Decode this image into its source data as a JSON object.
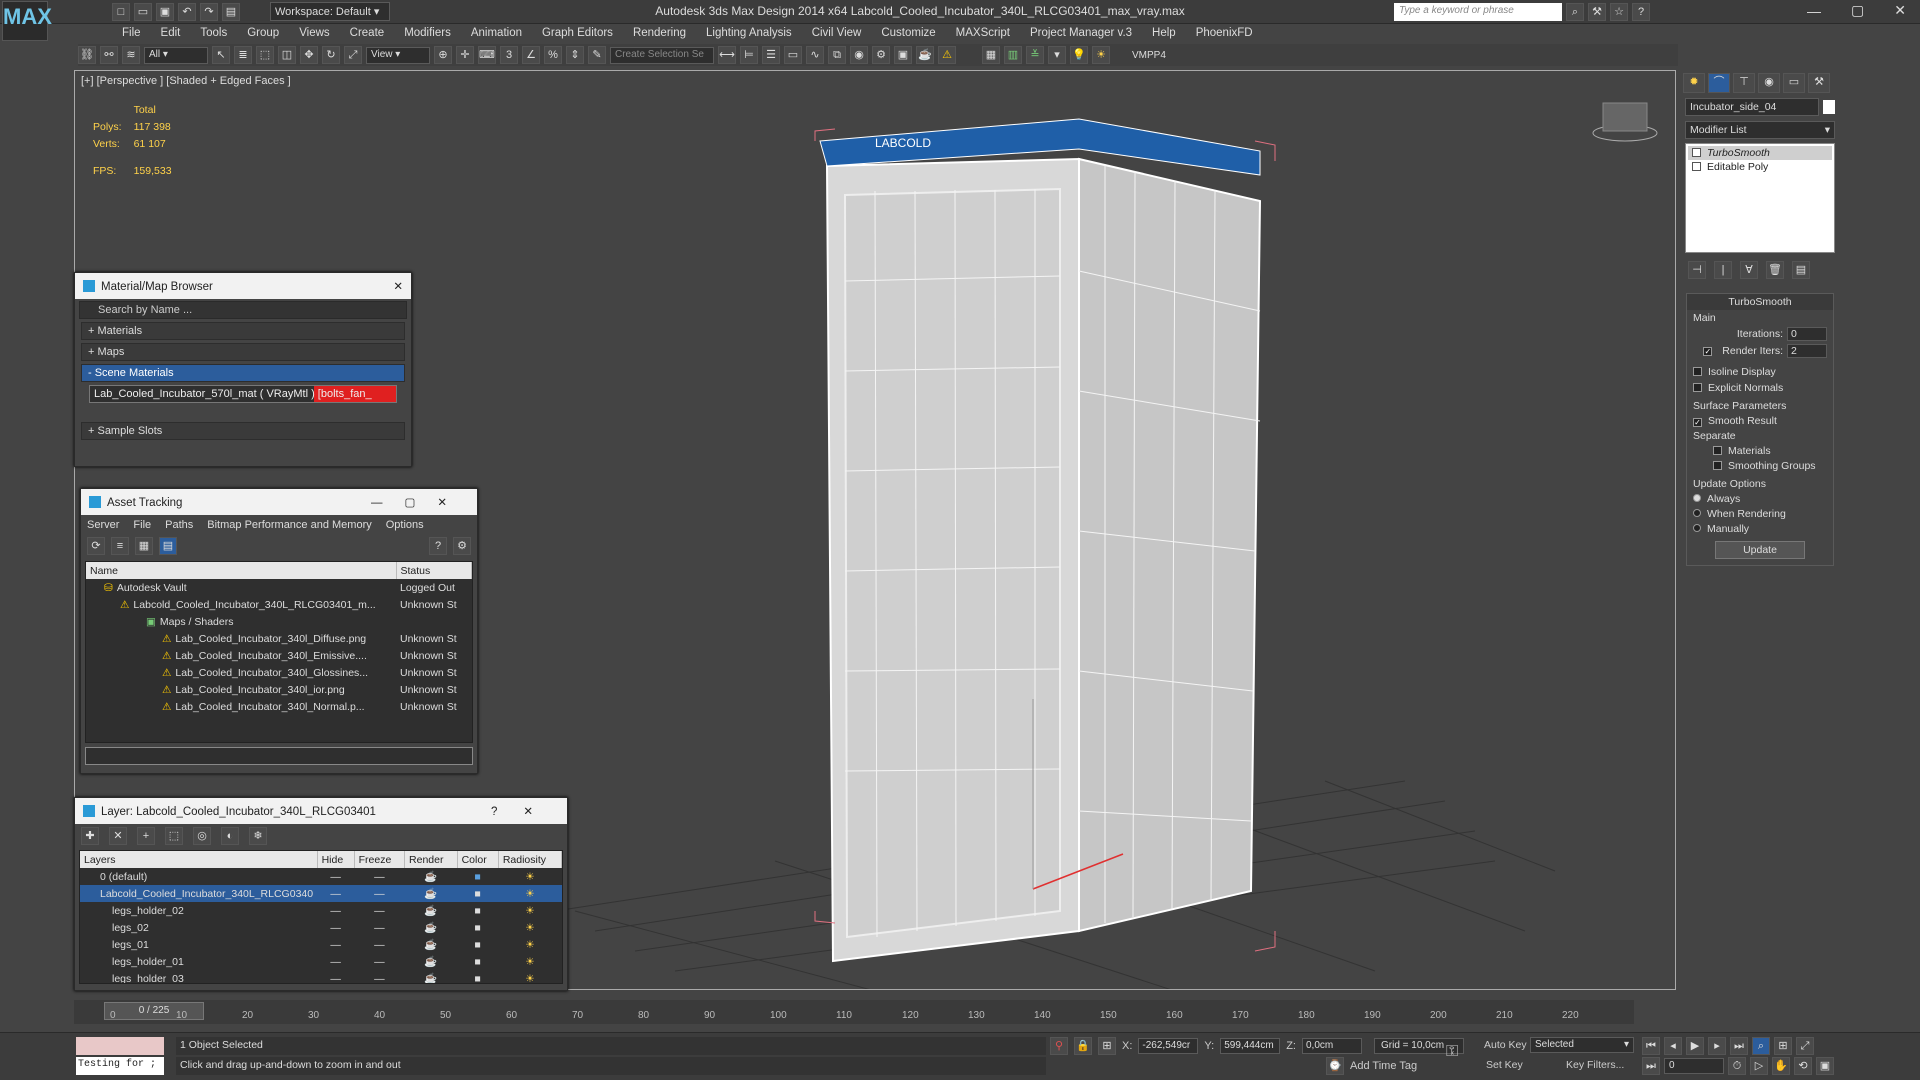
{
  "app": {
    "logo": "MAX",
    "window_title": "Autodesk 3ds Max Design 2014 x64       Labcold_Cooled_Incubator_340L_RLCG03401_max_vray.max",
    "workspace": "Workspace: Default",
    "search_placeholder": "Type a keyword or phrase"
  },
  "menu": [
    "File",
    "Edit",
    "Tools",
    "Group",
    "Views",
    "Create",
    "Modifiers",
    "Animation",
    "Graph Editors",
    "Rendering",
    "Lighting Analysis",
    "Civil View",
    "Customize",
    "MAXScript",
    "Project Manager v.3",
    "Help",
    "PhoenixFD"
  ],
  "toolbar": {
    "selection_filter": "All",
    "ref_coord": "View",
    "named_selection_placeholder": "Create Selection Se",
    "vmpp": "VMPP4"
  },
  "viewport": {
    "label": "[+] [Perspective ] [Shaded + Edged Faces ]",
    "stats": {
      "header": "Total",
      "polys_label": "Polys:",
      "polys": "117 398",
      "verts_label": "Verts:",
      "verts": "61 107",
      "fps_label": "FPS:",
      "fps": "159,533"
    }
  },
  "material_browser": {
    "title": "Material/Map Browser",
    "search_placeholder": "Search by Name ...",
    "sections": [
      "+ Materials",
      "+ Maps",
      "- Scene Materials"
    ],
    "material_item": "Lab_Cooled_Incubator_570l_mat ( VRayMtl ) [bolts_fan_",
    "sample_slots": "+ Sample Slots"
  },
  "asset_tracking": {
    "title": "Asset Tracking",
    "menu": [
      "Server",
      "File",
      "Paths",
      "Bitmap Performance and Memory",
      "Options"
    ],
    "col_name": "Name",
    "col_status": "Status",
    "rows": [
      {
        "name": "Autodesk Vault",
        "status": "Logged Out"
      },
      {
        "name": "Labcold_Cooled_Incubator_340L_RLCG03401_m...",
        "status": "Unknown St"
      },
      {
        "name": "Maps / Shaders",
        "status": ""
      },
      {
        "name": "Lab_Cooled_Incubator_340l_Diffuse.png",
        "status": "Unknown St"
      },
      {
        "name": "Lab_Cooled_Incubator_340l_Emissive....",
        "status": "Unknown St"
      },
      {
        "name": "Lab_Cooled_Incubator_340l_Glossines...",
        "status": "Unknown St"
      },
      {
        "name": "Lab_Cooled_Incubator_340l_ior.png",
        "status": "Unknown St"
      },
      {
        "name": "Lab_Cooled_Incubator_340l_Normal.p...",
        "status": "Unknown St"
      }
    ]
  },
  "layer_manager": {
    "title": "Layer: Labcold_Cooled_Incubator_340L_RLCG03401",
    "help": "?",
    "cols": [
      "Layers",
      "Hide",
      "Freeze",
      "Render",
      "Color",
      "Radiosity"
    ],
    "rows": [
      {
        "name": "0 (default)"
      },
      {
        "name": "Labcold_Cooled_Incubator_340L_RLCG0340"
      },
      {
        "name": "legs_holder_02"
      },
      {
        "name": "legs_02"
      },
      {
        "name": "legs_01"
      },
      {
        "name": "legs_holder_01"
      },
      {
        "name": "legs_holder_03"
      }
    ]
  },
  "command_panel": {
    "object_name": "Incubator_side_04",
    "modifier_list": "Modifier List",
    "stack": [
      "TurboSmooth",
      "Editable Poly"
    ],
    "turbosmooth": {
      "title": "TurboSmooth",
      "main": "Main",
      "iterations_label": "Iterations:",
      "iterations": "0",
      "render_iters_label": "Render Iters:",
      "render_iters": "2",
      "isoline": "Isoline Display",
      "explicit_normals": "Explicit Normals",
      "surface_params": "Surface Parameters",
      "smooth_result": "Smooth Result",
      "separate": "Separate",
      "materials": "Materials",
      "smoothing_groups": "Smoothing Groups",
      "update_options": "Update Options",
      "always": "Always",
      "when_rendering": "When Rendering",
      "manually": "Manually",
      "update_btn": "Update"
    }
  },
  "timeline": {
    "frame": "0 / 225",
    "ticks": [
      "0",
      "10",
      "20",
      "30",
      "40",
      "50",
      "60",
      "70",
      "80",
      "90",
      "100",
      "110",
      "120",
      "130",
      "140",
      "150",
      "160",
      "170",
      "180",
      "190",
      "200",
      "210",
      "220"
    ]
  },
  "status": {
    "script_text": "Testing for ;",
    "selected": "1 Object Selected",
    "prompt": "Click and drag up-and-down to zoom in and out",
    "x_label": "X:",
    "x": "-262,549cr",
    "y_label": "Y:",
    "y": "599,444cm",
    "z_label": "Z:",
    "z": "0,0cm",
    "grid": "Grid = 10,0cm",
    "add_time_tag": "Add Time Tag",
    "auto_key": "Auto Key",
    "set_key": "Set Key",
    "selected_dd": "Selected",
    "key_filters": "Key Filters...",
    "frame_field": "0"
  },
  "colors": {
    "accent": "#2c5d9c",
    "selection_red": "#e02020",
    "stats_yellow": "#ffd24a"
  }
}
